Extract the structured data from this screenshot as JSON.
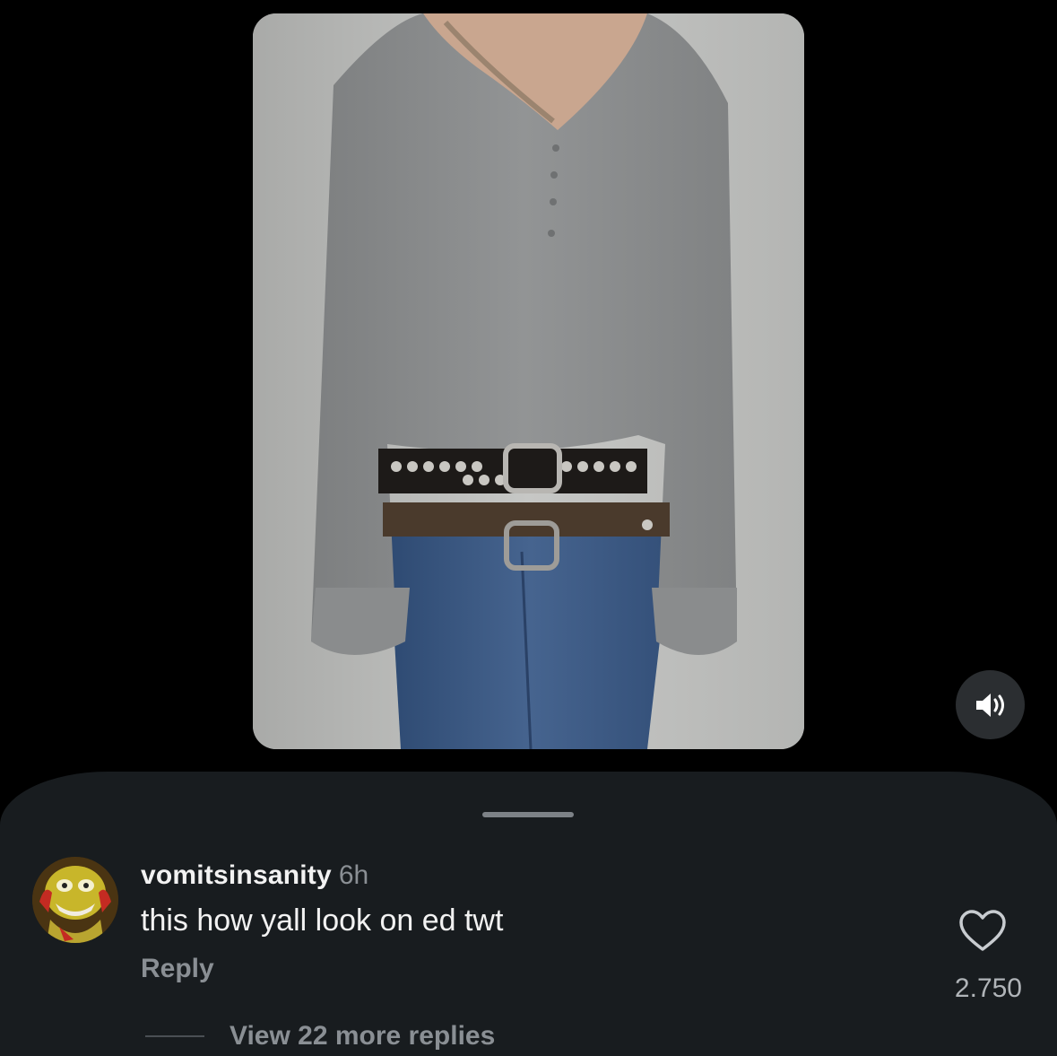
{
  "media": {
    "sound_icon": "speaker-volume-icon"
  },
  "comment": {
    "avatar_icon": "avatar-cartoon-face",
    "username": "vomitsinsanity",
    "timestamp": "6h",
    "text": "this how yall look on ed twt",
    "reply_label": "Reply",
    "like_icon": "heart-outline-icon",
    "like_count": "2.750",
    "view_replies_label": "View 22 more replies"
  },
  "colors": {
    "background": "#000000",
    "sheet": "#181c1f",
    "primary_text": "#f2f2f2",
    "secondary_text": "#8a8f94"
  }
}
